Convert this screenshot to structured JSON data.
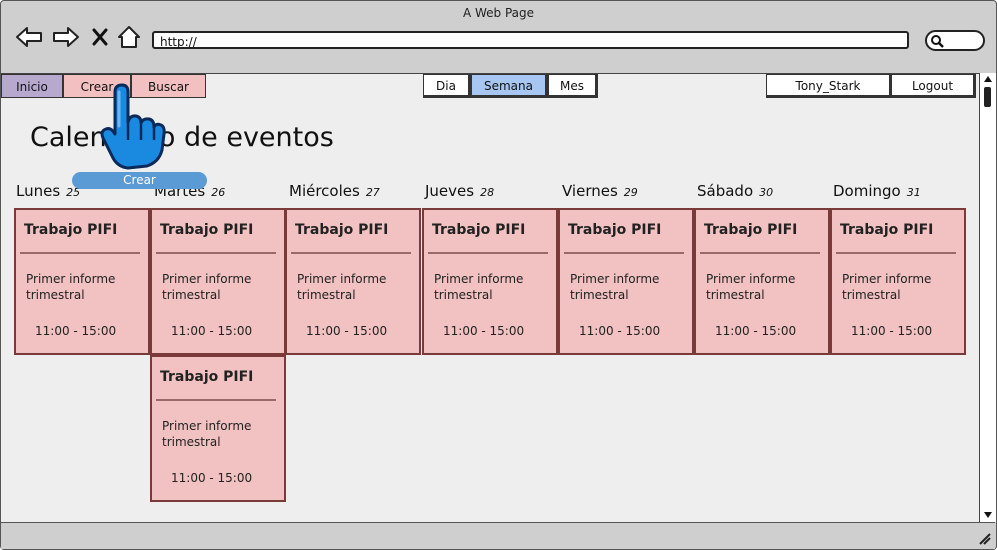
{
  "window": {
    "title": "A Web Page"
  },
  "browser": {
    "url": "http://"
  },
  "nav": {
    "tabs": [
      {
        "label": "Inicio"
      },
      {
        "label": "Crear"
      },
      {
        "label": "Buscar"
      }
    ]
  },
  "views": [
    {
      "label": "Dia",
      "active": false
    },
    {
      "label": "Semana",
      "active": true
    },
    {
      "label": "Mes",
      "active": false
    }
  ],
  "user": {
    "name": "Tony_Stark",
    "logout_label": "Logout"
  },
  "page": {
    "title": "Calendario de eventos"
  },
  "tooltip": {
    "label": "Crear"
  },
  "days": [
    {
      "name": "Lunes",
      "num": "25"
    },
    {
      "name": "Martes",
      "num": "26"
    },
    {
      "name": "Miércoles",
      "num": "27"
    },
    {
      "name": "Jueves",
      "num": "28"
    },
    {
      "name": "Viernes",
      "num": "29"
    },
    {
      "name": "Sábado",
      "num": "30"
    },
    {
      "name": "Domingo",
      "num": "31"
    }
  ],
  "event": {
    "title": "Trabajo PIFI",
    "description": "Primer informe trimestral",
    "time": "11:00 - 15:00"
  },
  "colors": {
    "inicio_tab": "#b7a9cd",
    "tab_pink": "#f2c0c0",
    "active_view": "#a7c6f2",
    "event_card": "#f2c2c2",
    "tooltip": "#5a9bd5"
  }
}
